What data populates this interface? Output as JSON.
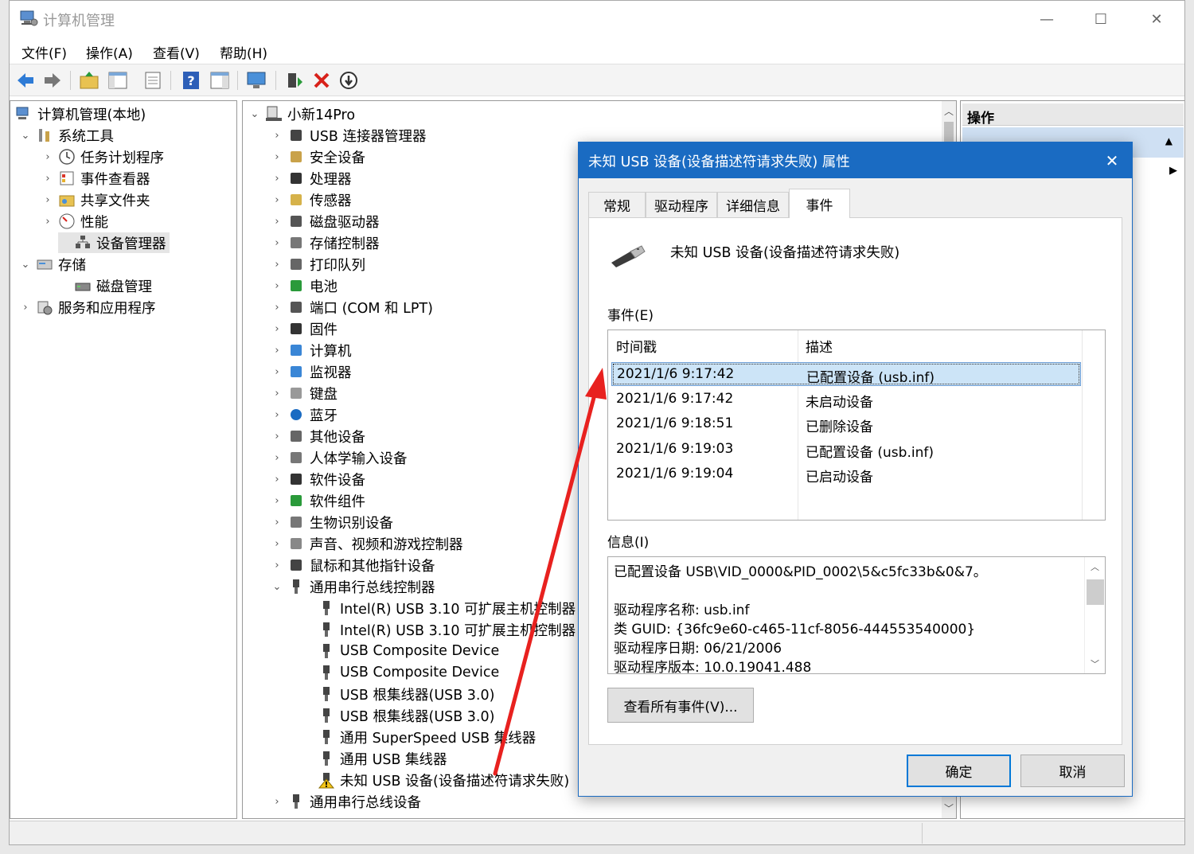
{
  "window": {
    "title": "计算机管理",
    "minimize": "—",
    "maximize": "☐",
    "close": "✕"
  },
  "menu": [
    "文件(F)",
    "操作(A)",
    "查看(V)",
    "帮助(H)"
  ],
  "left_tree": {
    "root": "计算机管理(本地)",
    "system_tools": "系统工具",
    "task_scheduler": "任务计划程序",
    "event_viewer": "事件查看器",
    "shared_folders": "共享文件夹",
    "performance": "性能",
    "device_manager": "设备管理器",
    "storage": "存储",
    "disk_management": "磁盘管理",
    "services_apps": "服务和应用程序"
  },
  "device_tree": {
    "root": "小新14Pro",
    "categories": [
      "USB 连接器管理器",
      "安全设备",
      "处理器",
      "传感器",
      "磁盘驱动器",
      "存储控制器",
      "打印队列",
      "电池",
      "端口 (COM 和 LPT)",
      "固件",
      "计算机",
      "监视器",
      "键盘",
      "蓝牙",
      "其他设备",
      "人体学输入设备",
      "软件设备",
      "软件组件",
      "生物识别设备",
      "声音、视频和游戏控制器",
      "鼠标和其他指针设备"
    ],
    "usb_controllers": "通用串行总线控制器",
    "usb_children": [
      "Intel(R) USB 3.10 可扩展主机控制器 -",
      "Intel(R) USB 3.10 可扩展主机控制器 -",
      "USB Composite Device",
      "USB Composite Device",
      "USB 根集线器(USB 3.0)",
      "USB 根集线器(USB 3.0)",
      "通用 SuperSpeed USB 集线器",
      "通用 USB 集线器",
      "未知 USB 设备(设备描述符请求失败)"
    ],
    "usb_devices": "通用串行总线设备"
  },
  "actions_pane": {
    "header": "操作"
  },
  "dialog": {
    "title": "未知 USB 设备(设备描述符请求失败) 属性",
    "close": "✕",
    "tabs": [
      "常规",
      "驱动程序",
      "详细信息",
      "事件"
    ],
    "device_name": "未知 USB 设备(设备描述符请求失败)",
    "events_label": "事件(E)",
    "col_timestamp": "时间戳",
    "col_description": "描述",
    "events": [
      {
        "time": "2021/1/6 9:17:42",
        "desc": "已配置设备 (usb.inf)"
      },
      {
        "time": "2021/1/6 9:17:42",
        "desc": "未启动设备"
      },
      {
        "time": "2021/1/6 9:18:51",
        "desc": "已删除设备"
      },
      {
        "time": "2021/1/6 9:19:03",
        "desc": "已配置设备 (usb.inf)"
      },
      {
        "time": "2021/1/6 9:19:04",
        "desc": "已启动设备"
      }
    ],
    "info_label": "信息(I)",
    "info_lines": [
      "已配置设备 USB\\VID_0000&PID_0002\\5&c5fc33b&0&7。",
      "",
      "驱动程序名称: usb.inf",
      "类 GUID: {36fc9e60-c465-11cf-8056-444553540000}",
      "驱动程序日期: 06/21/2006",
      "驱动程序版本: 10.0.19041.488"
    ],
    "view_all_button": "查看所有事件(V)...",
    "ok_button": "确定",
    "cancel_button": "取消"
  },
  "colors": {
    "accent": "#1a6bc2",
    "selection": "#cce4f7",
    "arrow": "#e8211f"
  }
}
